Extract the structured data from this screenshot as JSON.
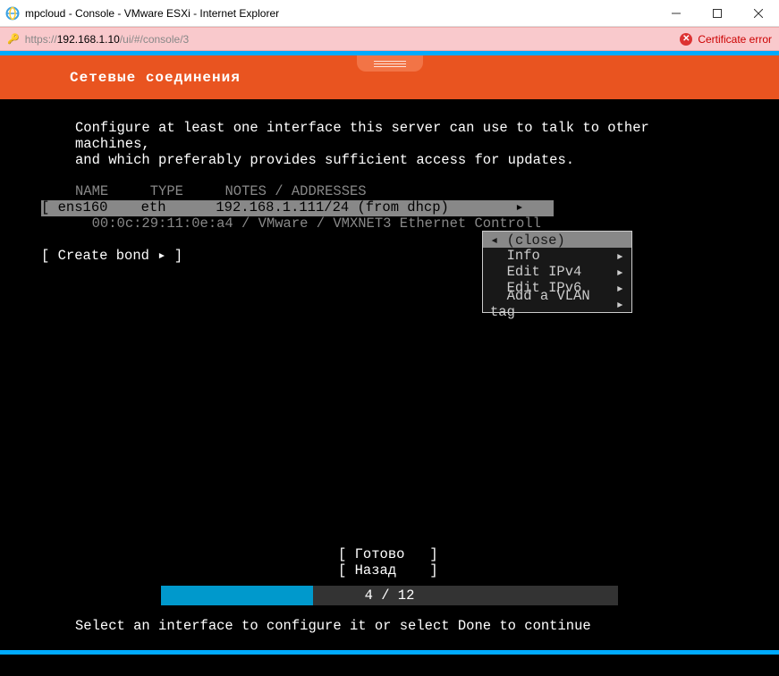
{
  "window": {
    "title": "mpcloud - Console - VMware ESXi - Internet Explorer"
  },
  "address": {
    "prefix": "https://",
    "host": "192.168.1.10",
    "path": "/ui/#/console/3",
    "cert_error": "Certificate error"
  },
  "installer": {
    "header_title": "Сетевые соединения",
    "description_line1": "Configure at least one interface this server can use to talk to other machines,",
    "description_line2": "and which preferably provides sufficient access for updates.",
    "columns": {
      "name": "NAME",
      "type": "TYPE",
      "notes": "NOTES / ADDRESSES"
    },
    "interface": {
      "name": "ens160",
      "type": "eth",
      "notes": "192.168.1.111/24 (from dhcp)",
      "arrow": "▸",
      "details": "00:0c:29:11:0e:a4 / VMware / VMXNET3 Ethernet Controll"
    },
    "create_bond": "Create bond ▸",
    "menu": {
      "close_arrow": "◂",
      "close": "(close)",
      "info": "Info",
      "edit_ipv4": "Edit IPv4",
      "edit_ipv6": "Edit IPv6",
      "add_vlan": "Add a VLAN tag",
      "arrow": "▸"
    },
    "buttons": {
      "done": "Готово",
      "back": "Назад"
    },
    "progress": "4 / 12",
    "hint": "Select an interface to configure it or select Done to continue"
  }
}
